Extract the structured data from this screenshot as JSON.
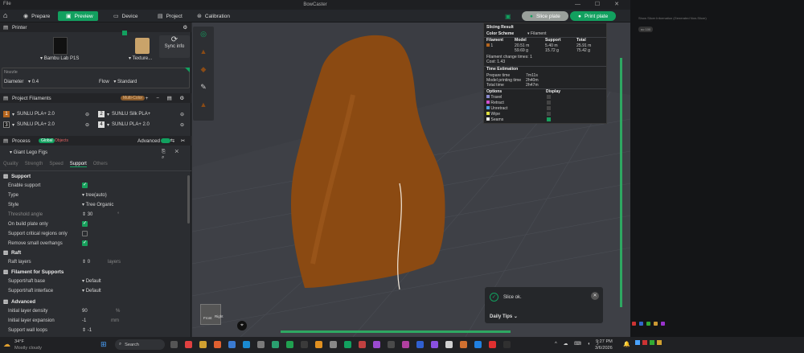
{
  "window": {
    "title": "BowCaster",
    "menu": "File",
    "controls": "— ☐ ✕"
  },
  "nav": {
    "home_icon": "home-icon",
    "tabs": [
      {
        "label": "Prepare",
        "icon": "prepare-icon"
      },
      {
        "label": "Preview",
        "icon": "preview-icon",
        "active": true
      },
      {
        "label": "Device",
        "icon": "device-icon"
      },
      {
        "label": "Project",
        "icon": "project-icon"
      },
      {
        "label": "Calibration",
        "icon": "calibration-icon"
      }
    ],
    "slice_plate": "Slice plate",
    "print_plate": "Print plate",
    "accent": "#12a05f"
  },
  "printer": {
    "section": "Printer",
    "name": "Bambu Lab P1S",
    "texture": "Texture...",
    "sync": "Sync info",
    "nozzle_label": "Nozzle",
    "diameter_label": "Diameter",
    "diameter_value": "0.4",
    "flow_label": "Flow",
    "flow_value": "Standard"
  },
  "filaments": {
    "section": "Project Filaments",
    "badge": "Multi-Color",
    "items": [
      {
        "num": "1",
        "name": "SUNLU PLA+ 2.0",
        "color": "#b5651d"
      },
      {
        "num": "2",
        "name": "SUNLU Silk PLA+",
        "color": "#dddddd"
      },
      {
        "num": "3",
        "name": "SUNLU PLA+ 2.0",
        "color": "#111111"
      },
      {
        "num": "4",
        "name": "SUNLU PLA+ 2.0",
        "color": "#dddddd"
      }
    ]
  },
  "process": {
    "section": "Process",
    "global": "Global",
    "objects": "Objects",
    "advanced": "Advanced",
    "preset": "Giant Lego Figs",
    "tabs": [
      "Quality",
      "Strength",
      "Speed",
      "Support",
      "Others"
    ],
    "support_header": "Support",
    "support_rows": [
      {
        "label": "Enable support",
        "type": "check",
        "on": true
      },
      {
        "label": "Type",
        "value": "tree(auto)"
      },
      {
        "label": "Style",
        "value": "Tree Organic"
      },
      {
        "label": "Threshold angle",
        "value": "30",
        "unit": "°"
      },
      {
        "label": "On build plate only",
        "type": "check",
        "on": true
      },
      {
        "label": "Support critical regions only",
        "type": "check",
        "on": false
      },
      {
        "label": "Remove small overhangs",
        "type": "check",
        "on": true
      }
    ],
    "raft_header": "Raft",
    "raft_layers_label": "Raft layers",
    "raft_layers_value": "0",
    "raft_layers_unit": "layers",
    "filament_header": "Filament for Supports",
    "support_base_label": "Support/raft base",
    "support_base_value": "Default",
    "support_iface_label": "Support/raft interface",
    "support_iface_value": "Default",
    "advanced_header": "Advanced",
    "density_label": "Initial layer density",
    "density_value": "90",
    "density_unit": "%",
    "expansion_label": "Initial layer expansion",
    "expansion_value": "-1",
    "expansion_unit": "mm",
    "wall_label": "Support wall loops",
    "wall_value": "-1"
  },
  "slicing": {
    "title": "Slicing Result",
    "color_scheme_label": "Color Scheme",
    "color_scheme_value": "Filament",
    "cols": [
      "Filament",
      "Model",
      "Support",
      "Total"
    ],
    "row": {
      "num": "1",
      "model_m": "20.51 m",
      "model_g": "59.69 g",
      "support_m": "5.40 m",
      "support_g": "15.72 g",
      "total_m": "25.91 m",
      "total_g": "75.42 g"
    },
    "change_times": "Filament change times: 1",
    "cost": "Cost: 1.43",
    "time_title": "Time Estimation",
    "prepare_label": "Prepare time",
    "prepare_value": "7m11s",
    "model_label": "Model printing time",
    "model_value": "2h40m",
    "total_label": "Total time",
    "total_value": "2h47m",
    "options_label": "Options",
    "display_label": "Display",
    "options": [
      {
        "label": "Travel",
        "color": "#8a8ad0",
        "on": false
      },
      {
        "label": "Retract",
        "color": "#d050d0",
        "on": false
      },
      {
        "label": "Unretract",
        "color": "#50a0e0",
        "on": false
      },
      {
        "label": "Wipe",
        "color": "#e0e040",
        "on": false
      },
      {
        "label": "Seams",
        "color": "#eeeeee",
        "on": true
      }
    ]
  },
  "toast": {
    "text": "Slice ok.",
    "tips": "Daily Tips"
  },
  "viewcube": {
    "front": "Front",
    "right": "Right"
  },
  "right_pane": {
    "line1": "Show Slicer Information (Generated Non-Slicer)",
    "badge": "no 100"
  },
  "taskbar": {
    "temp": "34°F",
    "weather": "Mostly cloudy",
    "search": "Search",
    "time": "9:27 PM",
    "date": "3/6/2026"
  }
}
